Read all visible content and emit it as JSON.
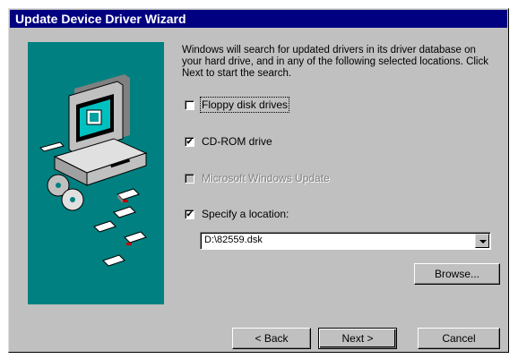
{
  "window": {
    "title": "Update Device Driver Wizard"
  },
  "description": "Windows will search for updated drivers in its driver database on your hard drive, and in any of the following selected locations. Click Next to start the search.",
  "options": [
    {
      "label": "Floppy disk drives",
      "checked": false,
      "enabled": true
    },
    {
      "label": "CD-ROM drive",
      "checked": true,
      "enabled": true
    },
    {
      "label": "Microsoft Windows Update",
      "checked": false,
      "enabled": false
    },
    {
      "label": "Specify a location:",
      "checked": true,
      "enabled": true
    }
  ],
  "location": {
    "value": "D:\\82559.dsk"
  },
  "buttons": {
    "browse": "Browse...",
    "back": "< Back",
    "next": "Next >",
    "cancel": "Cancel"
  },
  "colors": {
    "titlebar": "#000080",
    "art_bg": "#008080",
    "face": "#c0c0c0"
  }
}
